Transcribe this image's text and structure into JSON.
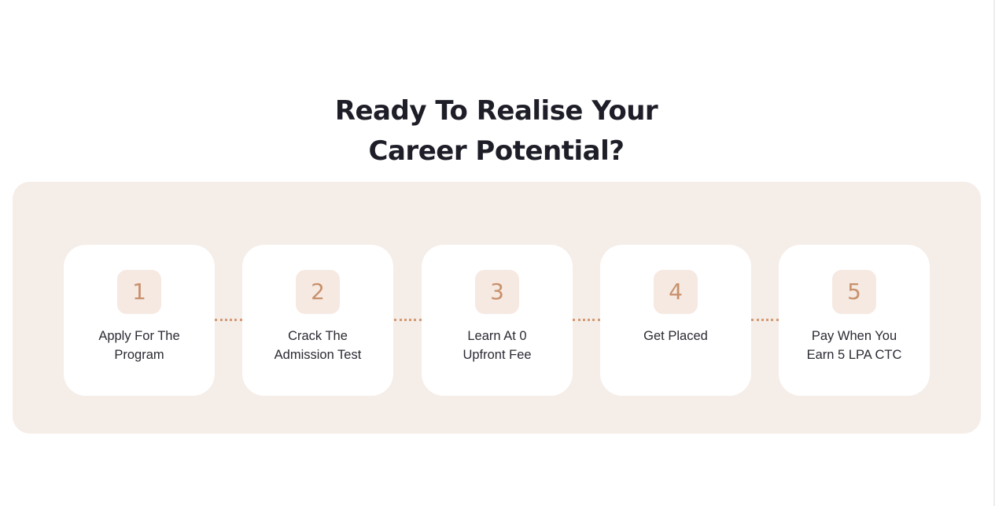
{
  "section": {
    "title_line1": "Ready To Realise Your",
    "title_line2": "Career Potential?"
  },
  "steps": [
    {
      "number": "1",
      "label": "Apply For The Program"
    },
    {
      "number": "2",
      "label": "Crack The Admission Test"
    },
    {
      "number": "3",
      "label": "Learn At 0 Upfront Fee"
    },
    {
      "number": "4",
      "label": "Get Placed"
    },
    {
      "number": "5",
      "label": "Pay When You Earn 5 LPA CTC"
    }
  ],
  "colors": {
    "panel_background": "#f5ede8",
    "accent": "#c9906b",
    "number_badge": "#f5e9e2",
    "title_text": "#1e1e28"
  }
}
